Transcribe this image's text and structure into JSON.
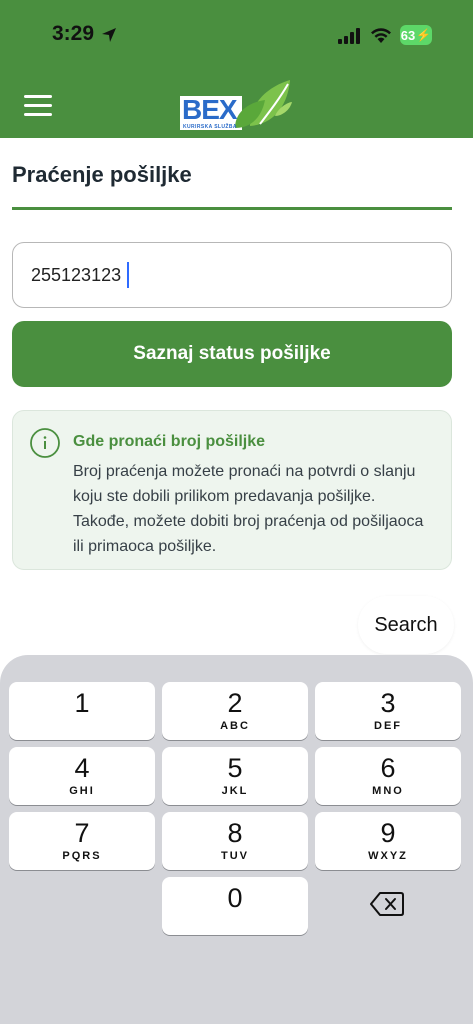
{
  "status_bar": {
    "time": "3:29",
    "battery": "63"
  },
  "header": {
    "logo_text": "BEX",
    "logo_sub": "KURIRSKA SLUŽBA"
  },
  "page": {
    "title": "Praćenje pošiljke",
    "tracking_value": "255123123",
    "button_label": "Saznaj status pošiljke"
  },
  "info": {
    "title": "Gde pronaći broj pošiljke",
    "text": "Broj praćenja možete pronaći na potvrdi o slanju koju ste dobili prilikom predavanja pošiljke. Takođe, možete dobiti broj praćenja od pošiljaoca ili primaoca pošiljke."
  },
  "keyboard": {
    "search_label": "Search",
    "keys": [
      {
        "num": "1",
        "letters": ""
      },
      {
        "num": "2",
        "letters": "ABC"
      },
      {
        "num": "3",
        "letters": "DEF"
      },
      {
        "num": "4",
        "letters": "GHI"
      },
      {
        "num": "5",
        "letters": "JKL"
      },
      {
        "num": "6",
        "letters": "MNO"
      },
      {
        "num": "7",
        "letters": "PQRS"
      },
      {
        "num": "8",
        "letters": "TUV"
      },
      {
        "num": "9",
        "letters": "WXYZ"
      },
      {
        "num": "0",
        "letters": ""
      }
    ]
  },
  "colors": {
    "brand_green": "#4a8f3f",
    "logo_blue": "#2a6bc9",
    "keyboard_bg": "#d3d4d9"
  }
}
